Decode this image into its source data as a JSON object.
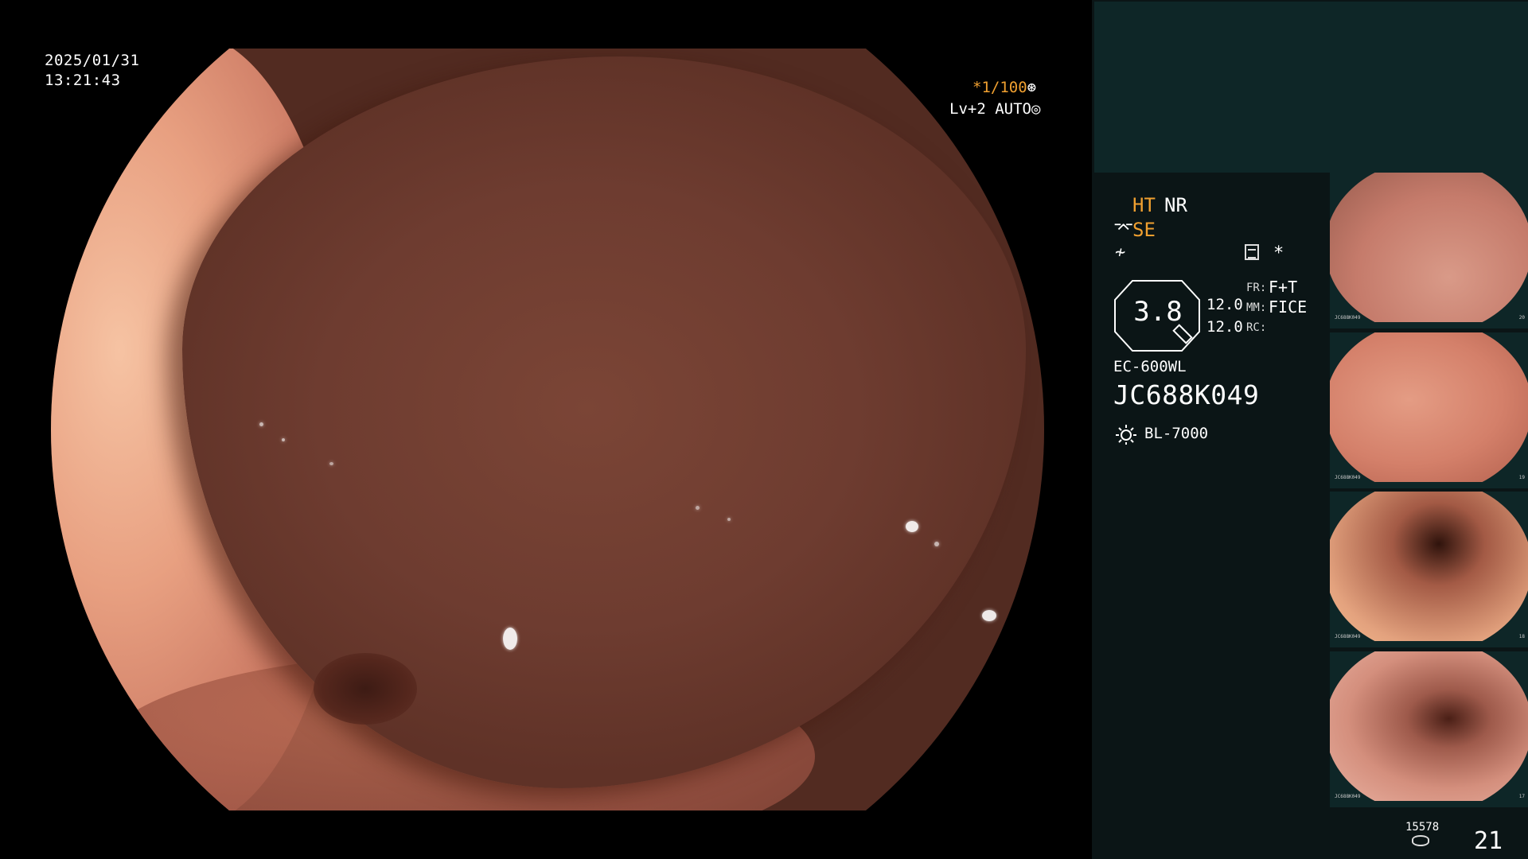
{
  "osd": {
    "date": "2025/01/31",
    "time": "13:21:43",
    "shutter": "*1/100",
    "level": "Lv+2 AUTO"
  },
  "panel": {
    "ht": "HT",
    "nr": "NR",
    "se": "SE",
    "star": "*",
    "zoom": "3.8",
    "value_1": "12.0",
    "value_2": "12.0",
    "fr_label": "FR:",
    "fr_value": "F+T",
    "mm_label": "MM:",
    "mm_value": "FICE",
    "rc_label": "RC:",
    "scope_model": "EC-600WL",
    "scope_serial": "JC688K049",
    "light_source": "BL-7000",
    "counter_small": "15578",
    "counter_big": "21"
  },
  "thumbnails": [
    {
      "serial": "JC688K049",
      "index": "20"
    },
    {
      "serial": "JC688K049",
      "index": "19"
    },
    {
      "serial": "JC688K049",
      "index": "18"
    },
    {
      "serial": "JC688K049",
      "index": "17"
    }
  ],
  "colors": {
    "accent_orange": "#f0a030",
    "panel_bg": "#0b1516",
    "panel_top_bg": "#0e2627"
  }
}
